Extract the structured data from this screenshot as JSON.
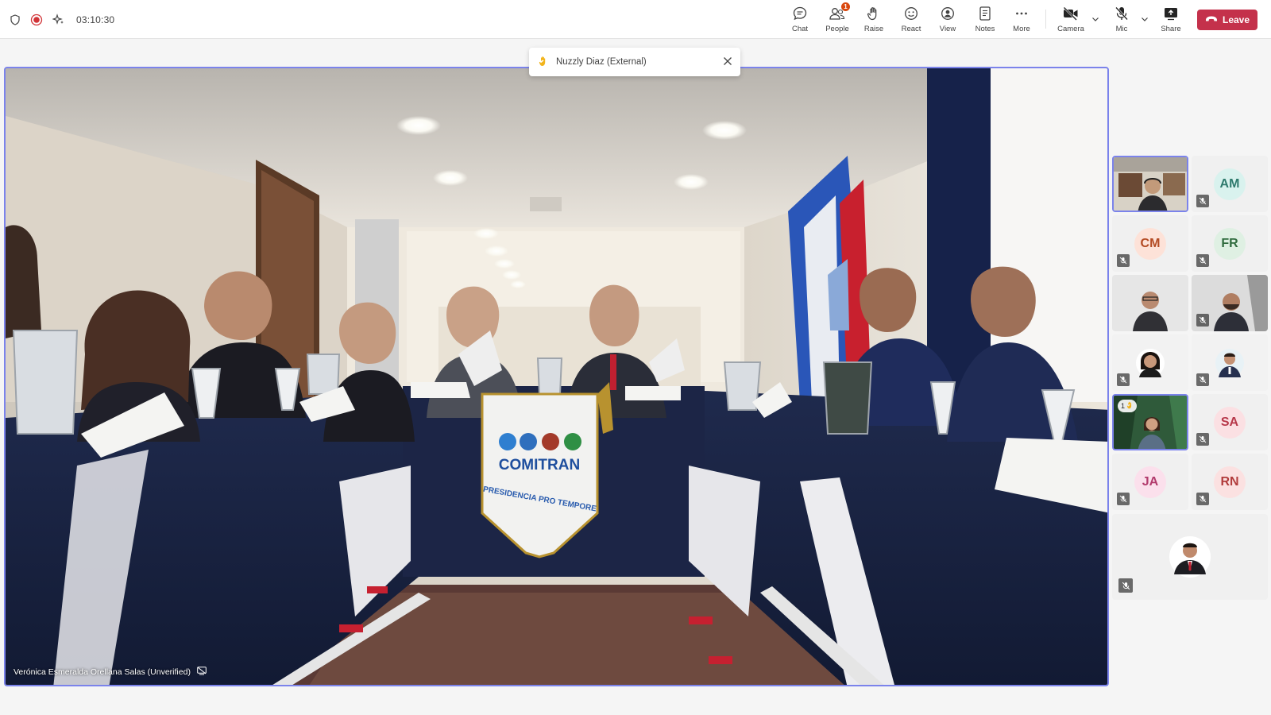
{
  "status": {
    "timer": "03:10:30"
  },
  "toolbar": {
    "chat": "Chat",
    "people": "People",
    "people_badge": "1",
    "raise": "Raise",
    "react": "React",
    "view": "View",
    "notes": "Notes",
    "more": "More",
    "camera": "Camera",
    "mic": "Mic",
    "share": "Share",
    "leave": "Leave"
  },
  "notification": {
    "text": "Nuzzly Diaz (External)"
  },
  "main_video": {
    "participant": "Verónica Esmeralda Orellana Salas (Unverified)",
    "banner_title": "COMITRAN",
    "banner_subtitle": "PRESIDENCIA PRO TEMPORE"
  },
  "gallery": {
    "tiles": [
      {
        "initials": "",
        "kind": "photo-man-headset"
      },
      {
        "initials": "AM",
        "avatar_bg": "#d9f2ee",
        "avatar_fg": "#2f7a6d"
      },
      {
        "initials": "CM",
        "avatar_bg": "#fde2d8",
        "avatar_fg": "#b34a23"
      },
      {
        "initials": "FR",
        "avatar_bg": "#dff0e3",
        "avatar_fg": "#2f6b3e"
      },
      {
        "initials": "",
        "kind": "photo-man-glasses"
      },
      {
        "initials": "",
        "kind": "photo-man-beard"
      },
      {
        "initials": "",
        "kind": "photo-woman"
      },
      {
        "initials": "",
        "kind": "photo-man-suit"
      },
      {
        "initials": "",
        "kind": "photo-woman-forest",
        "hand_count": "1"
      },
      {
        "initials": "SA",
        "avatar_bg": "#fbe0e3",
        "avatar_fg": "#b7384a"
      },
      {
        "initials": "JA",
        "avatar_bg": "#fbe0ec",
        "avatar_fg": "#b23a6c"
      },
      {
        "initials": "RN",
        "avatar_bg": "#fbe1e1",
        "avatar_fg": "#b13c3c"
      }
    ],
    "wide_tile": {
      "kind": "photo-man-tie"
    }
  },
  "colors": {
    "accent": "#7b83eb",
    "leave": "#c4314b",
    "recording": "#d13438"
  }
}
